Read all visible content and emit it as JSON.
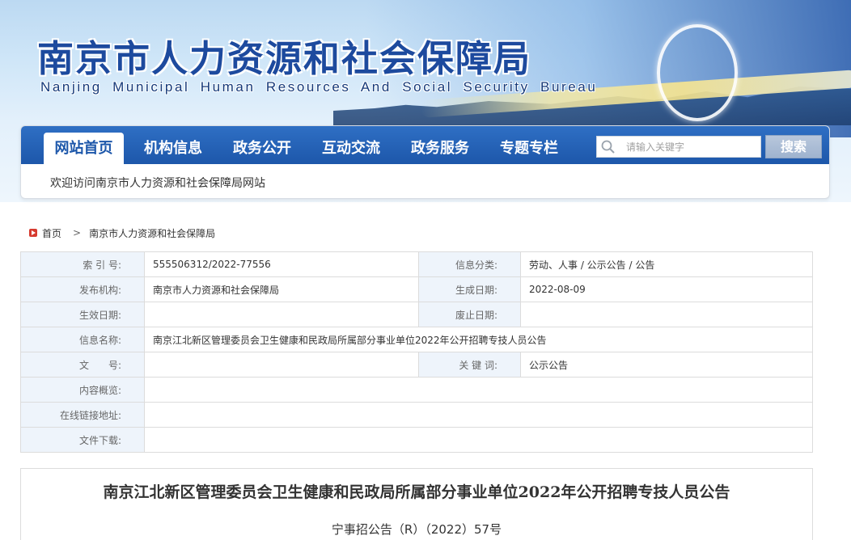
{
  "banner": {
    "title_cn": "南京市人力资源和社会保障局",
    "title_en": "Nanjing Municipal Human Resources And Social Security Bureau"
  },
  "nav": {
    "items": [
      {
        "label": "网站首页",
        "active": true
      },
      {
        "label": "机构信息",
        "active": false
      },
      {
        "label": "政务公开",
        "active": false
      },
      {
        "label": "互动交流",
        "active": false
      },
      {
        "label": "政务服务",
        "active": false
      },
      {
        "label": "专题专栏",
        "active": false
      }
    ],
    "search_placeholder": "请输入关键字",
    "search_button": "搜索",
    "welcome": "欢迎访问南京市人力资源和社会保障局网站"
  },
  "breadcrumb": {
    "home": "首页",
    "separator": ">",
    "current": "南京市人力资源和社会保障局"
  },
  "info": {
    "index_label": "索 引 号:",
    "index_value": "555506312/2022-77556",
    "category_label": "信息分类:",
    "category_value": "劳动、人事 / 公示公告 / 公告",
    "publisher_label": "发布机构:",
    "publisher_value": "南京市人力资源和社会保障局",
    "created_label": "生成日期:",
    "created_value": "2022-08-09",
    "effective_label": "生效日期:",
    "effective_value": "",
    "abolished_label": "废止日期:",
    "abolished_value": "",
    "name_label": "信息名称:",
    "name_value": "南京江北新区管理委员会卫生健康和民政局所属部分事业单位2022年公开招聘专技人员公告",
    "docno_label": "文　　号:",
    "docno_value": "",
    "keywords_label": "关 键 词:",
    "keywords_value": "公示公告",
    "summary_label": "内容概览:",
    "summary_value": "",
    "link_label": "在线链接地址:",
    "link_value": "",
    "download_label": "文件下载:",
    "download_value": ""
  },
  "article": {
    "title": "南京江北新区管理委员会卫生健康和民政局所属部分事业单位2022年公开招聘专技人员公告",
    "doc_number": "宁事招公告（R）（2022）57号"
  },
  "colors": {
    "nav_blue": "#1d57aa",
    "title_blue": "#1d4a9e",
    "label_bg": "#eef4fb",
    "breadcrumb_icon": "#d63a2f"
  },
  "icons": {
    "search": "search-icon",
    "home": "home-icon"
  }
}
